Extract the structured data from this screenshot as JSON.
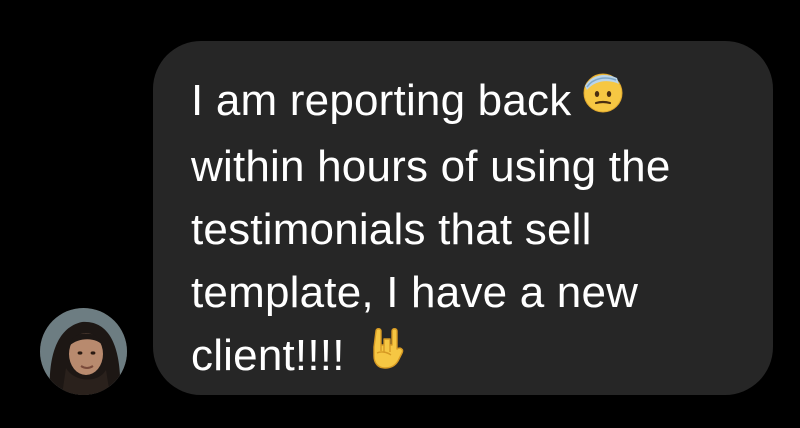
{
  "message": {
    "lines": [
      "I am reporting back",
      "within hours of using the",
      "testimonials that sell",
      "template, I have a new",
      "client!!!!"
    ]
  },
  "icons": {
    "emoji_line1": "saluting-face-emoji-icon",
    "emoji_line5": "sign-of-the-horns-emoji-icon"
  },
  "colors": {
    "background": "#000000",
    "bubble": "#262626",
    "text": "#ffffff"
  }
}
